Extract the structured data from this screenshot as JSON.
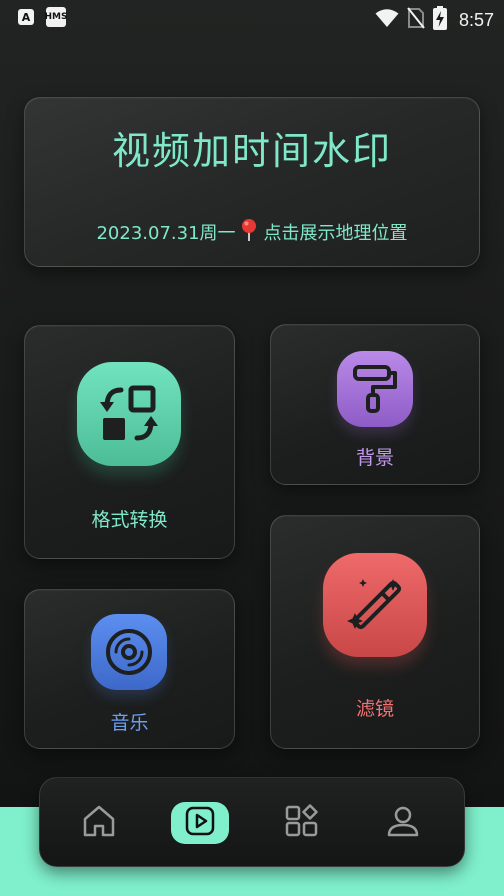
{
  "status_bar": {
    "time": "8:57",
    "left_badges": [
      "A",
      "HMS"
    ],
    "icons": [
      "wifi-icon",
      "no-sim-icon",
      "battery-charging-icon"
    ]
  },
  "header_card": {
    "title": "视频加时间水印",
    "date": "2023.07.31周一",
    "location_prompt": "点击展示地理位置",
    "pin_icon": "location-pin-icon"
  },
  "tiles": {
    "format": {
      "label": "格式转换",
      "icon": "format-convert-icon",
      "color": "#6fe0bd"
    },
    "background": {
      "label": "背景",
      "icon": "paint-roller-icon",
      "color": "#b07ee0"
    },
    "music": {
      "label": "音乐",
      "icon": "music-disc-icon",
      "color": "#5a86e8"
    },
    "filter": {
      "label": "滤镜",
      "icon": "magic-wand-icon",
      "color": "#e85a5a"
    }
  },
  "bottom_nav": {
    "items": [
      {
        "name": "home",
        "icon": "home-icon",
        "active": false
      },
      {
        "name": "play",
        "icon": "play-icon",
        "active": true
      },
      {
        "name": "apps",
        "icon": "apps-grid-icon",
        "active": false
      },
      {
        "name": "profile",
        "icon": "person-icon",
        "active": false
      }
    ],
    "accent": "#7ff0cb"
  }
}
